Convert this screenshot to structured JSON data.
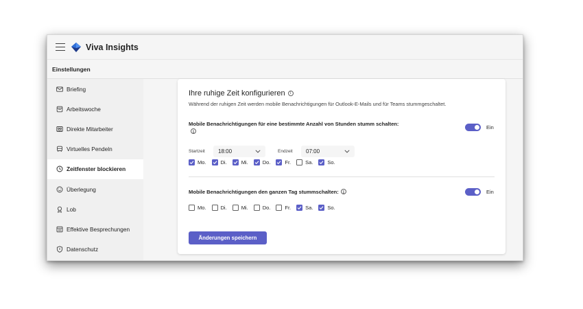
{
  "app": {
    "title": "Viva Insights"
  },
  "breadcrumb": "Einstellungen",
  "sidebar": {
    "items": [
      {
        "label": "Briefing",
        "icon": "mail-icon"
      },
      {
        "label": "Arbeitswoche",
        "icon": "calendar-icon"
      },
      {
        "label": "Direkte Mitarbeiter",
        "icon": "people-icon"
      },
      {
        "label": "Virtuelles Pendeln",
        "icon": "vehicle-icon"
      },
      {
        "label": "Zeitfenster blockieren",
        "icon": "clock-icon",
        "active": true
      },
      {
        "label": "Überlegung",
        "icon": "smiley-icon"
      },
      {
        "label": "Lob",
        "icon": "ribbon-icon"
      },
      {
        "label": "Effektive Besprechungen",
        "icon": "calendar-grid-icon"
      },
      {
        "label": "Datenschutz",
        "icon": "shield-icon"
      }
    ]
  },
  "card": {
    "title": "Ihre ruhige Zeit konfigurieren",
    "description": "Während der ruhigen Zeit werden mobile Benachrichtigungen für Outlook-E-Mails und für Teams stummgeschaltet.",
    "section1": {
      "label": "Mobile Benachrichtigungen für eine bestimmte Anzahl von Stunden stumm schalten:",
      "toggle_label": "Ein",
      "toggle_on": true,
      "start_label": "Startzeit",
      "start_value": "18:00",
      "end_label": "Endzeit",
      "end_value": "07:00",
      "days": [
        {
          "label": "Mo.",
          "checked": true
        },
        {
          "label": "Di.",
          "checked": true
        },
        {
          "label": "Mi.",
          "checked": true
        },
        {
          "label": "Do.",
          "checked": true
        },
        {
          "label": "Fr.",
          "checked": true
        },
        {
          "label": "Sa.",
          "checked": false
        },
        {
          "label": "So.",
          "checked": true
        }
      ]
    },
    "section2": {
      "label": "Mobile Benachrichtigungen den ganzen Tag stummschalten:",
      "toggle_label": "Ein",
      "toggle_on": true,
      "days": [
        {
          "label": "Mo.",
          "checked": false
        },
        {
          "label": "Di.",
          "checked": false
        },
        {
          "label": "Mi.",
          "checked": false
        },
        {
          "label": "Do.",
          "checked": false
        },
        {
          "label": "Fr.",
          "checked": false
        },
        {
          "label": "Sa.",
          "checked": true
        },
        {
          "label": "So.",
          "checked": true
        }
      ]
    },
    "save_label": "Änderungen speichern"
  },
  "colors": {
    "accent": "#5b5fc7",
    "logo_dark": "#1e3a8a",
    "logo_light": "#4f8ff0"
  }
}
